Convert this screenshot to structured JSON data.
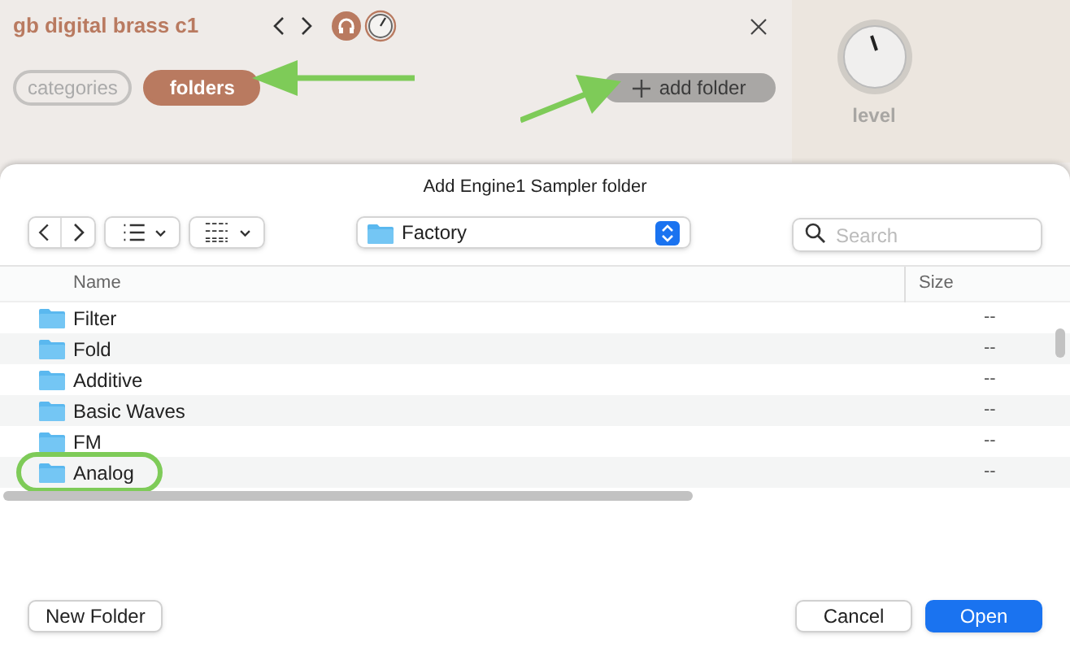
{
  "app": {
    "title": "gb digital brass c1",
    "tabs": [
      {
        "label": "categories",
        "selected": false
      },
      {
        "label": "folders",
        "selected": true
      }
    ],
    "add_button": "add folder",
    "knob": {
      "label": "level"
    }
  },
  "dialog": {
    "title": "Add Engine1 Sampler folder",
    "location": "Factory",
    "search": {
      "placeholder": "Search"
    },
    "columns": [
      "Name",
      "Size"
    ],
    "rows": [
      {
        "name": "Filter",
        "size": "--",
        "circled": false
      },
      {
        "name": "Fold",
        "size": "--",
        "circled": false
      },
      {
        "name": "Additive",
        "size": "--",
        "circled": false
      },
      {
        "name": "Basic Waves",
        "size": "--",
        "circled": false
      },
      {
        "name": "FM",
        "size": "--",
        "circled": false
      },
      {
        "name": "Analog",
        "size": "--",
        "circled": true
      }
    ],
    "buttons": [
      {
        "label": "New Folder",
        "primary": false
      },
      {
        "label": "Cancel",
        "primary": false
      },
      {
        "label": "Open",
        "primary": true
      }
    ]
  }
}
